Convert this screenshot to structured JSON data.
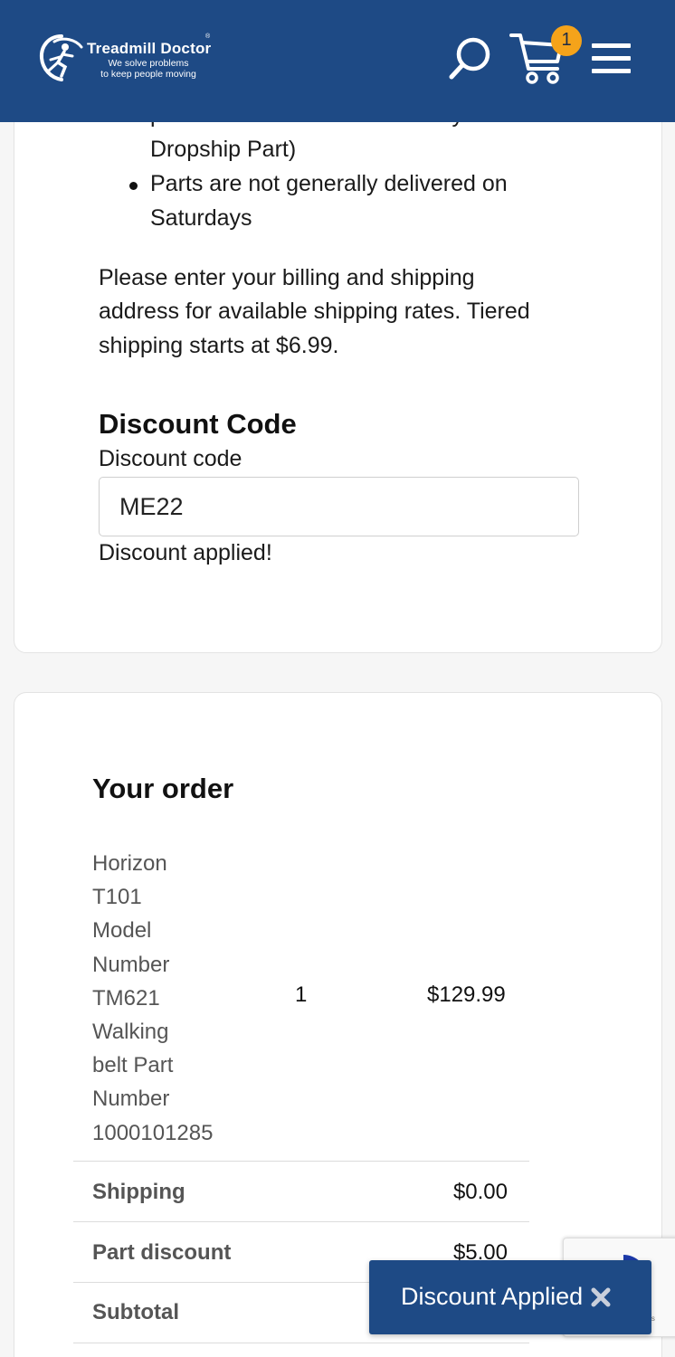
{
  "header": {
    "brand_name": "Treadmill Doctor",
    "brand_reg": "®",
    "tagline_line1": "We solve problems",
    "tagline_line2": "to keep people moving",
    "cart_count": "1",
    "background_color": "#1e4a85",
    "badge_color": "#f5a31a",
    "icons": [
      "search-icon",
      "cart-icon",
      "hamburger-menu-icon"
    ]
  },
  "shipping_info": {
    "cut_line": "provide faster deliveries on any",
    "bullet1_line2": "Dropship Part)",
    "bullet2_line1": "Parts are not generally delivered on",
    "bullet2_line2": "Saturdays",
    "note_line1": "Please enter your billing and shipping",
    "note_line2": "address for available shipping rates. Tiered",
    "note_line3": "shipping starts at $6.99."
  },
  "discount": {
    "heading": "Discount Code",
    "label": "Discount code",
    "value": "ME22",
    "status": "Discount applied!"
  },
  "order": {
    "title": "Your order",
    "item": {
      "name_lines": [
        "Horizon",
        "T101",
        "Model",
        "Number",
        "TM621",
        "Walking",
        "belt Part",
        "Number",
        "1000101285"
      ],
      "quantity": "1",
      "price": "$129.99"
    },
    "rows": [
      {
        "label": "Shipping",
        "value": "$0.00"
      },
      {
        "label": "Part discount",
        "value": "$5.00"
      },
      {
        "label": "Subtotal",
        "value": ""
      }
    ]
  },
  "toast": {
    "message": "Discount Applied",
    "close_icon": "close-x-icon"
  },
  "recaptcha": {
    "fragment": "nes"
  }
}
